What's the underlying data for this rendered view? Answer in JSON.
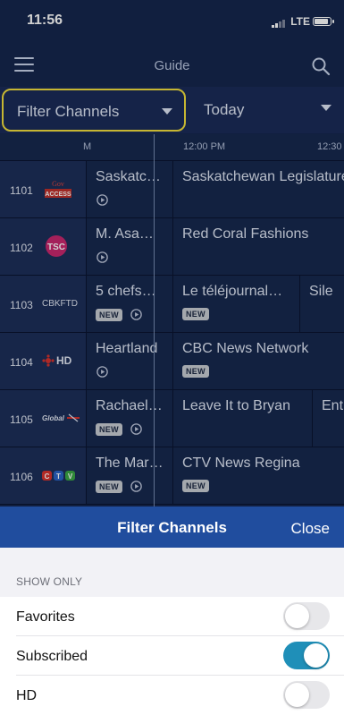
{
  "status_bar": {
    "time": "11:56",
    "network": "LTE"
  },
  "nav": {
    "title": "Guide"
  },
  "filters": {
    "channel_filter_label": "Filter Channels",
    "day_label": "Today"
  },
  "time_header": {
    "prev_slot": "M",
    "slot_1": "12:00 PM",
    "slot_2": "12:30"
  },
  "rows": [
    {
      "number": "1101",
      "logo": "Gov ACCESS",
      "first": {
        "title": "Saskatc…",
        "new": false,
        "replay": true
      },
      "second": {
        "title": "Saskatchewan Legislature",
        "new": false
      }
    },
    {
      "number": "1102",
      "logo": "TSC",
      "first": {
        "title": "M. Asa…",
        "new": false,
        "replay": true
      },
      "second": {
        "title": "Red Coral Fashions",
        "new": false
      }
    },
    {
      "number": "1103",
      "logo": "CBKFTD",
      "first": {
        "title": "5 chefs…",
        "new": true,
        "replay": true
      },
      "second": {
        "title": "Le téléjournal…",
        "new": true
      },
      "third": {
        "title": "Sile"
      }
    },
    {
      "number": "1104",
      "logo": "HD",
      "first": {
        "title": "Heartland",
        "new": false,
        "replay": true
      },
      "second": {
        "title": "CBC News Network",
        "new": true
      }
    },
    {
      "number": "1105",
      "logo": "Global",
      "first": {
        "title": "Rachael…",
        "new": true,
        "replay": true
      },
      "second": {
        "title": "Leave It to Bryan",
        "new": false
      },
      "third": {
        "title": "Ent"
      }
    },
    {
      "number": "1106",
      "logo": "CTV",
      "first": {
        "title": "The Mar…",
        "new": true,
        "replay": true
      },
      "second": {
        "title": "CTV News Regina",
        "new": true
      }
    }
  ],
  "badge_text": "NEW",
  "sheet": {
    "title": "Filter Channels",
    "close_label": "Close",
    "section_label": "SHOW ONLY",
    "options": [
      {
        "label": "Favorites",
        "on": false
      },
      {
        "label": "Subscribed",
        "on": true
      },
      {
        "label": "HD",
        "on": false
      }
    ]
  },
  "colors": {
    "accent": "#1f8fb8",
    "highlight": "#f2df3d",
    "header_blue": "#204d9e",
    "background": "#15264e"
  }
}
